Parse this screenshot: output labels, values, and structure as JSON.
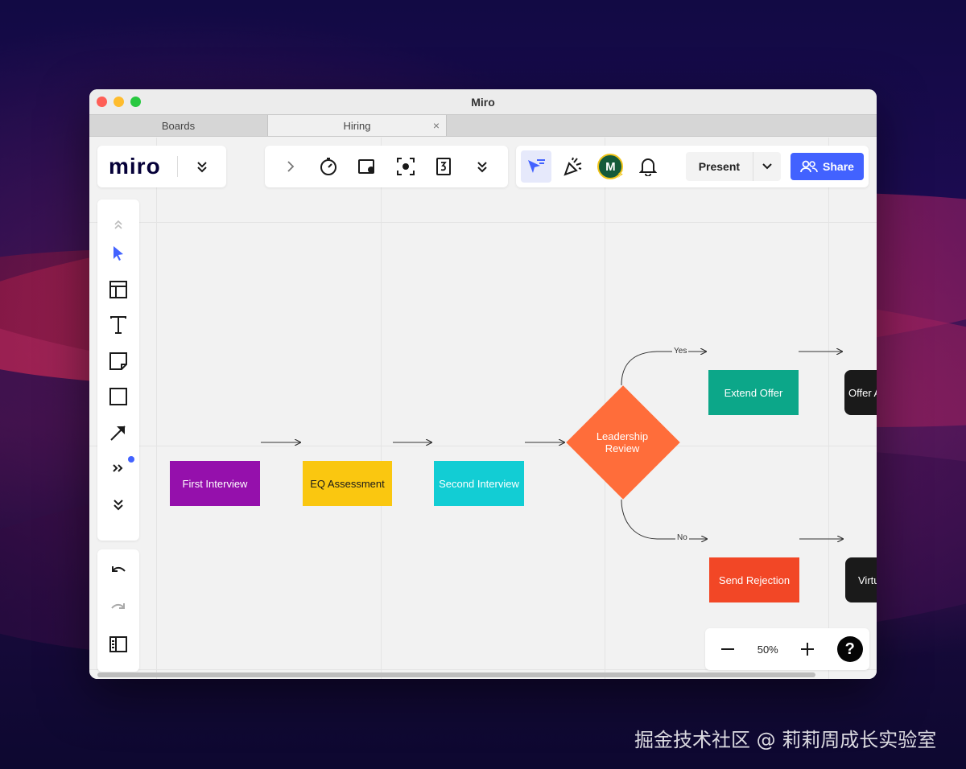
{
  "window": {
    "title": "Miro"
  },
  "tabs": [
    {
      "label": "Boards",
      "active": false
    },
    {
      "label": "Hiring",
      "active": true,
      "close": "×"
    }
  ],
  "toolbar": {
    "logo": "miro",
    "present_label": "Present",
    "share_label": "Share",
    "avatar_initial": "M"
  },
  "zoom": {
    "level": "50%",
    "minus": "−",
    "plus": "+",
    "help": "?"
  },
  "flow": {
    "first_interview": "First Interview",
    "eq_assessment": "EQ Assessment",
    "second_interview": "Second Interview",
    "leadership_review": "Leadership Review",
    "extend_offer": "Extend Offer",
    "send_rejection": "Send Rejection",
    "offer_accepted": "Offer A",
    "virtual": "Virtu",
    "yes_label": "Yes",
    "no_label": "No"
  },
  "colors": {
    "accent": "#4262ff",
    "first_interview": "#9510ac",
    "eq_assessment": "#fac710",
    "second_interview": "#12cdd4",
    "leadership_review": "#ff6d3a",
    "extend_offer": "#0ca789",
    "send_rejection": "#f24726"
  },
  "watermark": "掘金技术社区 @ 莉莉周成长实验室"
}
